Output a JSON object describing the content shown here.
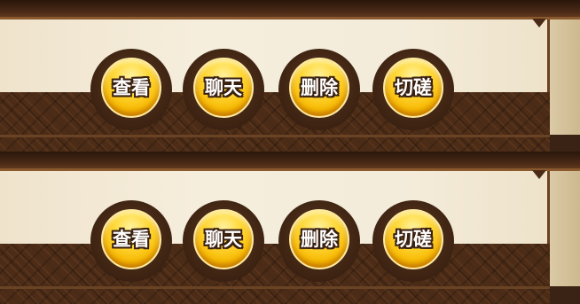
{
  "rows": [
    {
      "buttons": {
        "view": "查看",
        "chat": "聊天",
        "delete": "删除",
        "spar": "切磋"
      }
    },
    {
      "buttons": {
        "view": "查看",
        "chat": "聊天",
        "delete": "删除",
        "spar": "切磋"
      }
    }
  ],
  "colors": {
    "button_gold": "#f7b800",
    "button_ring": "#3f2413",
    "panel_cream": "#f4ecda",
    "band_brown": "#4c2c17"
  }
}
